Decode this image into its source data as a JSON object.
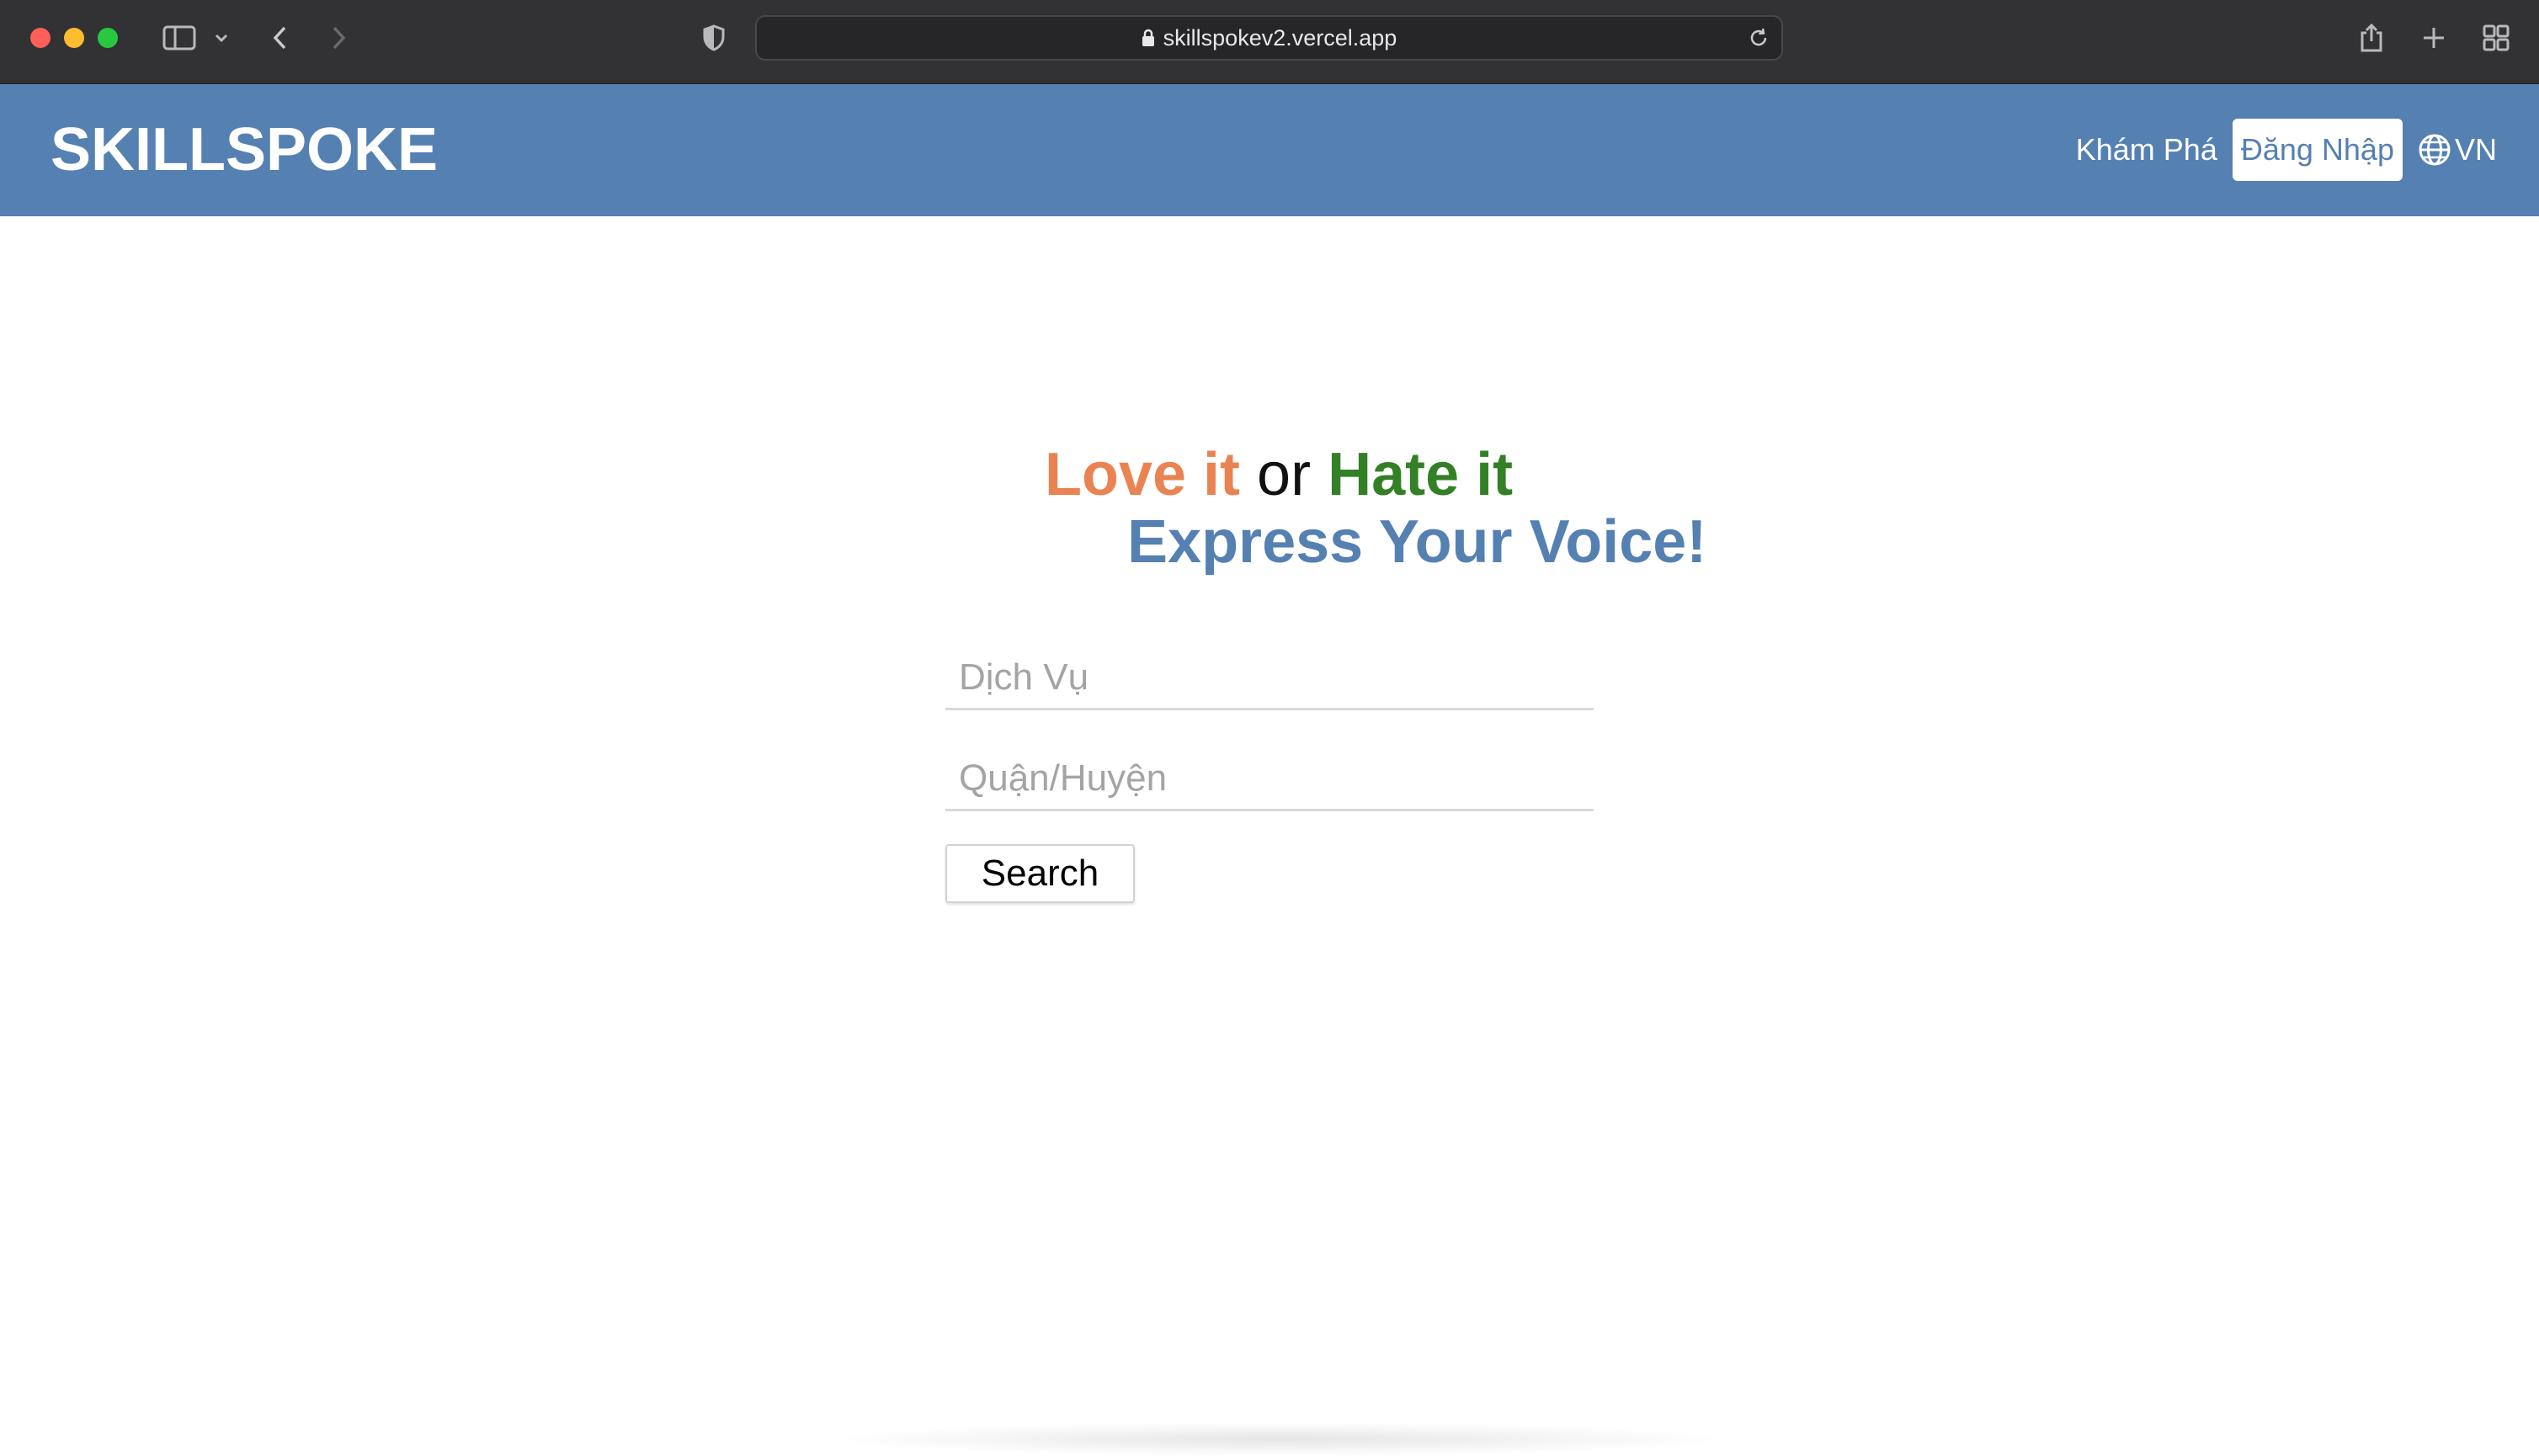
{
  "browser": {
    "url": "skillspokev2.vercel.app",
    "icons": {
      "sidebar": "sidebar-icon",
      "chevron": "chevron-down-icon",
      "back": "back-arrow-icon",
      "forward": "forward-arrow-icon",
      "shield": "shield-icon",
      "lock": "lock-icon",
      "reload": "reload-icon",
      "share": "share-icon",
      "new_tab": "plus-icon",
      "tabs": "tab-overview-icon"
    }
  },
  "header": {
    "brand": "SKILLSPOKE",
    "nav_explore": "Khám Phá",
    "login": "Đăng Nhập",
    "lang": "VN",
    "colors": {
      "background": "#5580b2",
      "text": "#ffffff"
    }
  },
  "hero": {
    "love": "Love it",
    "or": "or",
    "hate": "Hate it",
    "tagline": "Express Your Voice!",
    "colors": {
      "love": "#ea8352",
      "hate": "#338026",
      "tagline": "#5580b2"
    }
  },
  "search": {
    "service_placeholder": "Dịch Vụ",
    "district_placeholder": "Quận/Huyện",
    "button": "Search"
  }
}
